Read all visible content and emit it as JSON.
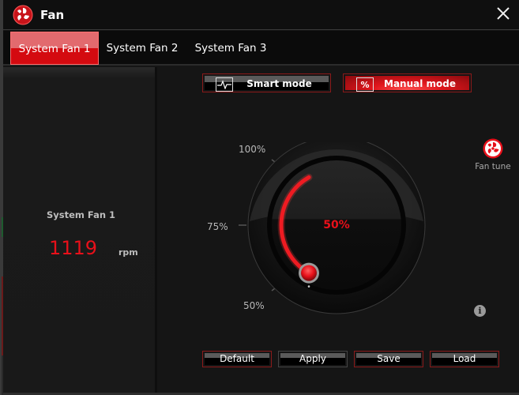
{
  "window": {
    "title": "Fan",
    "close_icon": "close-icon",
    "logo_icon": "fan-logo-icon"
  },
  "tabs": [
    {
      "label": "System Fan 1",
      "active": true
    },
    {
      "label": "System Fan 2",
      "active": false
    },
    {
      "label": "System Fan 3",
      "active": false
    }
  ],
  "status": {
    "fan_name": "System Fan 1",
    "speed": "1119",
    "unit": "rpm"
  },
  "modes": {
    "smart": {
      "label": "Smart mode",
      "icon": "waveform-icon",
      "active": false
    },
    "manual": {
      "label": "Manual mode",
      "icon_text": "%",
      "active": true
    }
  },
  "dial": {
    "value_text": "50%",
    "value_percent": 50,
    "min_percent": 50,
    "max_percent": 100,
    "labels": {
      "top": "100%",
      "mid": "75%",
      "bottom": "50%"
    },
    "accent_color": "#e8101a"
  },
  "fan_tune": {
    "label": "Fan tune",
    "icon": "fan-tune-icon"
  },
  "info": {
    "icon": "info-icon",
    "glyph": "i"
  },
  "actions": {
    "default": "Default",
    "apply": "Apply",
    "save": "Save",
    "load": "Load"
  }
}
